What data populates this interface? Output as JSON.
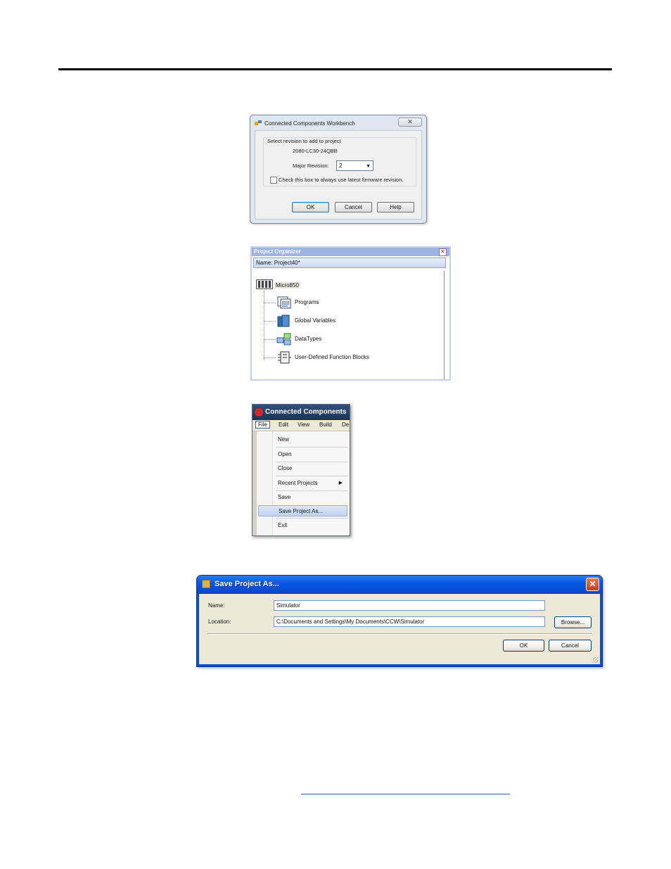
{
  "revision_dialog": {
    "title": "Connected Components Workbench",
    "close_glyph": "✕",
    "group_label": "Select revision to add to project",
    "model": "2080-LC30-24QBB",
    "major_revision_label": "Major Revision:",
    "major_revision_value": "2",
    "dropdown_arrow": "▼",
    "checkbox_label": "Check this box to always use latest firmware revision.",
    "checkbox_checked": false,
    "buttons": {
      "ok": "OK",
      "cancel": "Cancel",
      "help": "Help"
    }
  },
  "project_organizer": {
    "title": "Project Organizer",
    "close_glyph": "×",
    "name_label": "Name:",
    "name_value": "Project40*",
    "root": "Micro850",
    "items": [
      {
        "label": "Programs",
        "icon": "programs-icon"
      },
      {
        "label": "Global Variables",
        "icon": "global-variables-icon"
      },
      {
        "label": "DataTypes",
        "icon": "datatypes-icon"
      },
      {
        "label": "User-Defined Function Blocks",
        "icon": "function-blocks-icon"
      }
    ]
  },
  "file_menu": {
    "app_title": "Connected Components",
    "menubar": [
      "File",
      "Edit",
      "View",
      "Build",
      "De"
    ],
    "items": [
      "New",
      "Open",
      "Close",
      "Recent Projects",
      "Save",
      "Save Project As...",
      "Exit"
    ],
    "selected_item": "Save Project As...",
    "submenu_arrow": "▶"
  },
  "save_dialog": {
    "title": "Save Project As...",
    "close_glyph": "✕",
    "name_label": "Name:",
    "name_value": "Simulator",
    "location_label": "Location:",
    "location_value": "C:\\Documents and Settings\\My Documents\\CCW\\Simulator",
    "buttons": {
      "browse": "Browse...",
      "ok": "OK",
      "cancel": "Cancel"
    }
  },
  "colors": {
    "xp_title_blue": "#0858e3",
    "organizer_title": "#9db4e0",
    "menu_title": "#1b3357",
    "link_underline": "#3355cc"
  }
}
